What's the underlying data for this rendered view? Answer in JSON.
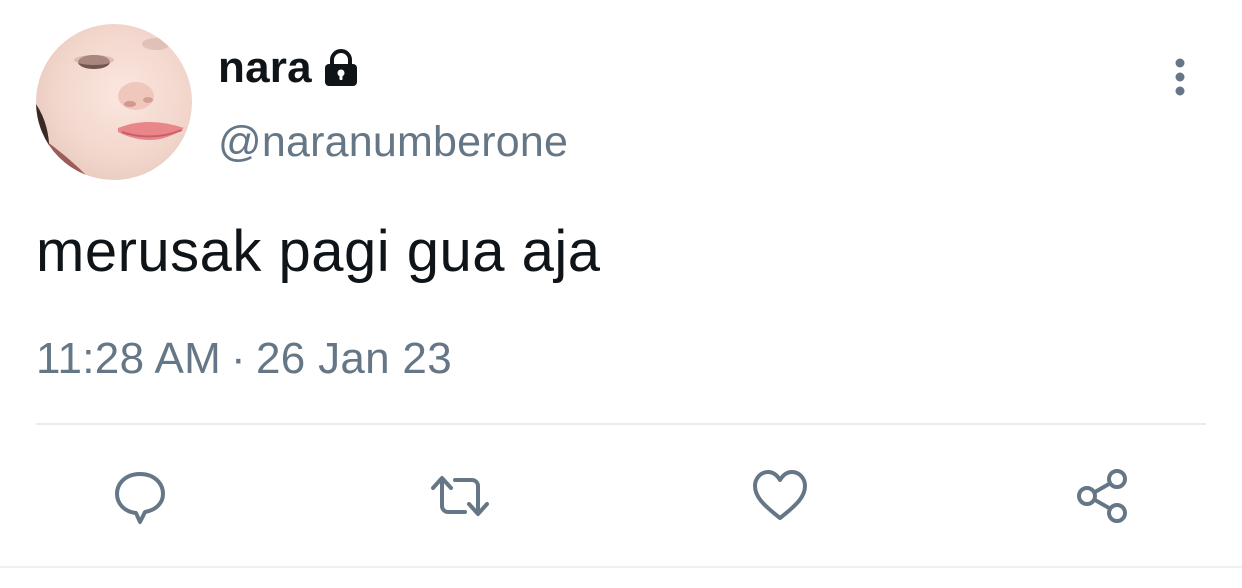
{
  "user": {
    "display_name": "nara",
    "handle": "@naranumberone",
    "protected": true,
    "avatar_icon": "profile-photo"
  },
  "tweet": {
    "text": "merusak pagi gua aja",
    "time": "11:28 AM",
    "separator": "·",
    "date": "26 Jan 23"
  },
  "actions": [
    {
      "name": "reply",
      "icon": "speech-bubble-icon"
    },
    {
      "name": "retweet",
      "icon": "retweet-arrows-icon"
    },
    {
      "name": "like",
      "icon": "heart-icon"
    },
    {
      "name": "share",
      "icon": "share-nodes-icon"
    }
  ],
  "colors": {
    "text_primary": "#0f1419",
    "text_secondary": "#657786",
    "divider": "#e6ecf0"
  }
}
